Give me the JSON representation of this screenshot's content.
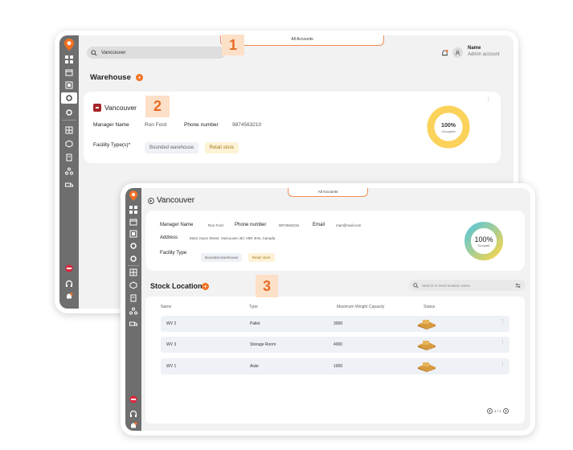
{
  "annotations": [
    "1",
    "2",
    "3"
  ],
  "sidebar": {
    "brand_color": "#f27121",
    "icons": [
      "dashboard-icon",
      "box-icon",
      "building-icon",
      "settings-icon",
      "gear-icon",
      "grid-icon",
      "cube-icon",
      "document-icon",
      "network-icon",
      "truck-icon",
      "flag-icon",
      "headset-icon",
      "bell-icon"
    ]
  },
  "screen1": {
    "tab_label": "All Accounts",
    "search_value": "Vancouver",
    "user_name": "Name",
    "user_role": "Admin account",
    "section_title": "Warehouse",
    "warehouse": {
      "name": "Vancouver",
      "manager_label": "Manager Name",
      "manager_value": "Ron Ford",
      "phone_label": "Phone number",
      "phone_value": "9874563210",
      "facility_label": "Facility Type(s)*",
      "facility_types": [
        "Bounded warehouse",
        "Retail store"
      ],
      "occupancy": "100%",
      "occupancy_label": "Occupied"
    }
  },
  "screen2": {
    "tab_label": "All Accounts",
    "title": "Vancouver",
    "manager_label": "Manager Name",
    "manager_value": "Ron Ford",
    "phone_label": "Phone number",
    "phone_value": "9874563210",
    "email_label": "Email",
    "email_value": "man@mail.com",
    "address_label": "Address",
    "address_value": "5522 Joyce Street, Vancouver, BC V5R 4H6, Canada",
    "facility_label": "Facility Type",
    "facility_types": [
      "Bounded warehouse",
      "Retail store"
    ],
    "occupancy": "100%",
    "occupancy_label": "Occupied",
    "stock_title": "Stock Location",
    "stock_search_placeholder": "Search in stock location name",
    "columns": [
      "Name",
      "Type",
      "Maximum Weight Capacity",
      "Status"
    ],
    "rows": [
      {
        "name": "WV 2",
        "type": "Pallet",
        "capacity": "3000"
      },
      {
        "name": "WV 3",
        "type": "Storage Room",
        "capacity": "4000"
      },
      {
        "name": "WV 1",
        "type": "Aisle",
        "capacity": "1000"
      }
    ],
    "pagination": "1 / 1"
  }
}
